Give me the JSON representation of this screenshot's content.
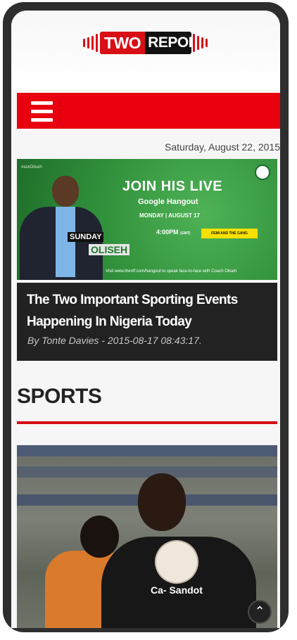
{
  "header": {
    "logo_left": "TWO",
    "logo_right": "REPORT"
  },
  "nav": {
    "menu_icon": "hamburger-menu-icon"
  },
  "date": "Saturday, August 22, 2015",
  "featured": {
    "banner": {
      "tag": "#askOliseh",
      "name_first": "SUNDAY",
      "name_last": "OLISEH",
      "headline": "JOIN HIS LIVE",
      "subheadline": "Google Hangout",
      "when": "MONDAY | AUGUST 17",
      "time": "4:00PM",
      "time_zone": "(GMT)",
      "highlight": "FEMI AND THE GANG",
      "footer": "Visit www.thenff.com/hangout to speak face-to-face with Coach Oliseh"
    },
    "title": "The Two Important Sporting Events Happening In Nigeria Today",
    "meta": "By Tonte Davies - 2015-08-17 08:43:17."
  },
  "section": {
    "title": "SPORTS"
  },
  "photo": {
    "shirt_text": "Ca- Sandot"
  },
  "controls": {
    "scroll_top_icon": "chevron-up-icon"
  },
  "colors": {
    "accent": "#e8000f",
    "article_bg": "#222222",
    "rule": "#d40e14"
  }
}
